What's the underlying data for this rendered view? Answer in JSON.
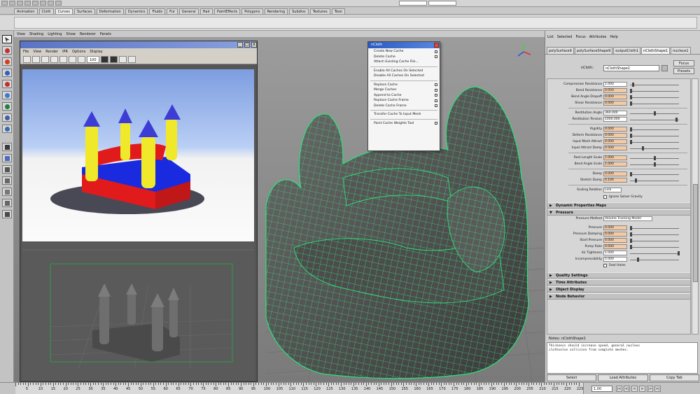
{
  "shelf": {
    "tabs": [
      "Animation",
      "Cloth",
      "Curves",
      "Surfaces",
      "Deformation",
      "Dynamics",
      "Fluids",
      "Fur",
      "General",
      "Hair",
      "PaintEffects",
      "Polygons",
      "Rendering",
      "Subdivs",
      "Textures",
      "Toon"
    ]
  },
  "panel_menu": [
    "View",
    "Shading",
    "Lighting",
    "Show",
    "Renderer",
    "Panels"
  ],
  "render_view": {
    "menu": [
      "File",
      "View",
      "Render",
      "IPR",
      "Options",
      "Display"
    ],
    "zoom": "100"
  },
  "ncloth_menu": {
    "title": "nCloth",
    "items": [
      {
        "label": "Create New Cache",
        "box": true
      },
      {
        "label": "Delete Cache",
        "box": true
      },
      {
        "label": "Attach Existing Cache File...",
        "box": false
      },
      {
        "sep": true
      },
      {
        "label": "Enable All Caches On Selected",
        "box": false
      },
      {
        "label": "Disable All Caches On Selected",
        "box": false
      },
      {
        "sep": true
      },
      {
        "label": "Replace Cache",
        "box": true
      },
      {
        "label": "Merge Caches",
        "box": true
      },
      {
        "label": "Append to Cache",
        "box": true
      },
      {
        "label": "Replace Cache Frame",
        "box": true
      },
      {
        "label": "Delete Cache Frame",
        "box": true
      },
      {
        "sep": true
      },
      {
        "label": "Transfer Cache To Input Mesh",
        "box": false
      },
      {
        "sep": true
      },
      {
        "label": "Paint Cache Weights Tool",
        "box": true
      }
    ]
  },
  "attribute_editor": {
    "menu": [
      "List",
      "Selected",
      "Focus",
      "Attributes",
      "Help"
    ],
    "tabs": [
      "polySurface9",
      "polySurfaceShape9",
      "outputCloth1",
      "nClothShape1",
      "nucleus1"
    ],
    "active_tab": 3,
    "node_label": "nCloth:",
    "node_value": "nClothShape1",
    "focus_btn": "Focus",
    "presets_btn": "Presets",
    "rows_a": [
      {
        "label": "Compression Resistance",
        "value": "1.000",
        "key": false
      },
      {
        "label": "Bend Resistance",
        "value": "0.050",
        "key": true
      },
      {
        "label": "Bend Angle Dropoff",
        "value": "0.000",
        "key": true
      },
      {
        "label": "Shear Resistance",
        "value": "0.000",
        "key": true
      }
    ],
    "rows_b": [
      {
        "label": "Restitution Angle",
        "value": "360.000",
        "key": false
      },
      {
        "label": "Restitution Tension",
        "value": "1000.000",
        "key": false
      }
    ],
    "rows_c": [
      {
        "label": "Rigidity",
        "value": "0.000",
        "key": true
      },
      {
        "label": "Deform Resistance",
        "value": "0.000",
        "key": true
      },
      {
        "label": "Input Mesh Attract",
        "value": "0.000",
        "key": true
      },
      {
        "label": "Input Attract Damp",
        "value": "0.500",
        "key": true
      }
    ],
    "rows_d": [
      {
        "label": "Rest Length Scale",
        "value": "1.000",
        "key": true
      },
      {
        "label": "Bend Angle Scale",
        "value": "1.000",
        "key": true
      }
    ],
    "rows_e": [
      {
        "label": "Damp",
        "value": "0.000",
        "key": true
      },
      {
        "label": "Stretch Damp",
        "value": "0.100",
        "key": true
      }
    ],
    "scaling_relation_label": "Scaling Relation",
    "scaling_relation_value": "Link",
    "ignore_solver_gravity": "Ignore Solver Gravity",
    "section_dynamic": "Dynamic Properties Maps",
    "section_pressure": "Pressure",
    "pressure_method_label": "Pressure Method",
    "pressure_method_value": "Volume Tracking Model",
    "rows_p": [
      {
        "label": "Pressure",
        "value": "0.000",
        "key": true
      },
      {
        "label": "Pressure Damping",
        "value": "0.000",
        "key": true
      },
      {
        "label": "Start Pressure",
        "value": "0.000",
        "key": true
      },
      {
        "label": "Pump Rate",
        "value": "0.000",
        "key": true
      },
      {
        "label": "Air Tightness",
        "value": "1.000",
        "key": false
      },
      {
        "label": "Incompressibility",
        "value": "5.000",
        "key": false
      }
    ],
    "seal_holes": "Seal Holes",
    "sections_collapsed": [
      "Quality Settings",
      "Time Attributes",
      "Object Display",
      "Node Behavior"
    ],
    "notes_header": "Notes: nClothShape1",
    "notes_text": "Thickness should increase speed, general nucleus\nclothsolve collision from complete meshes.",
    "buttons": [
      "Select",
      "Load Attributes",
      "Copy Tab"
    ]
  },
  "timeline": {
    "labels": [
      "5",
      "10",
      "15",
      "20",
      "25",
      "30",
      "35",
      "40",
      "45",
      "50",
      "55",
      "60",
      "65",
      "70",
      "75",
      "80",
      "85",
      "90",
      "95",
      "100",
      "105",
      "110",
      "115",
      "120",
      "125",
      "130",
      "135",
      "140",
      "145",
      "150",
      "155",
      "160",
      "165",
      "170",
      "175",
      "180",
      "185",
      "190",
      "195",
      "200",
      "205",
      "210",
      "215",
      "220",
      "225"
    ],
    "current": "1.00"
  }
}
